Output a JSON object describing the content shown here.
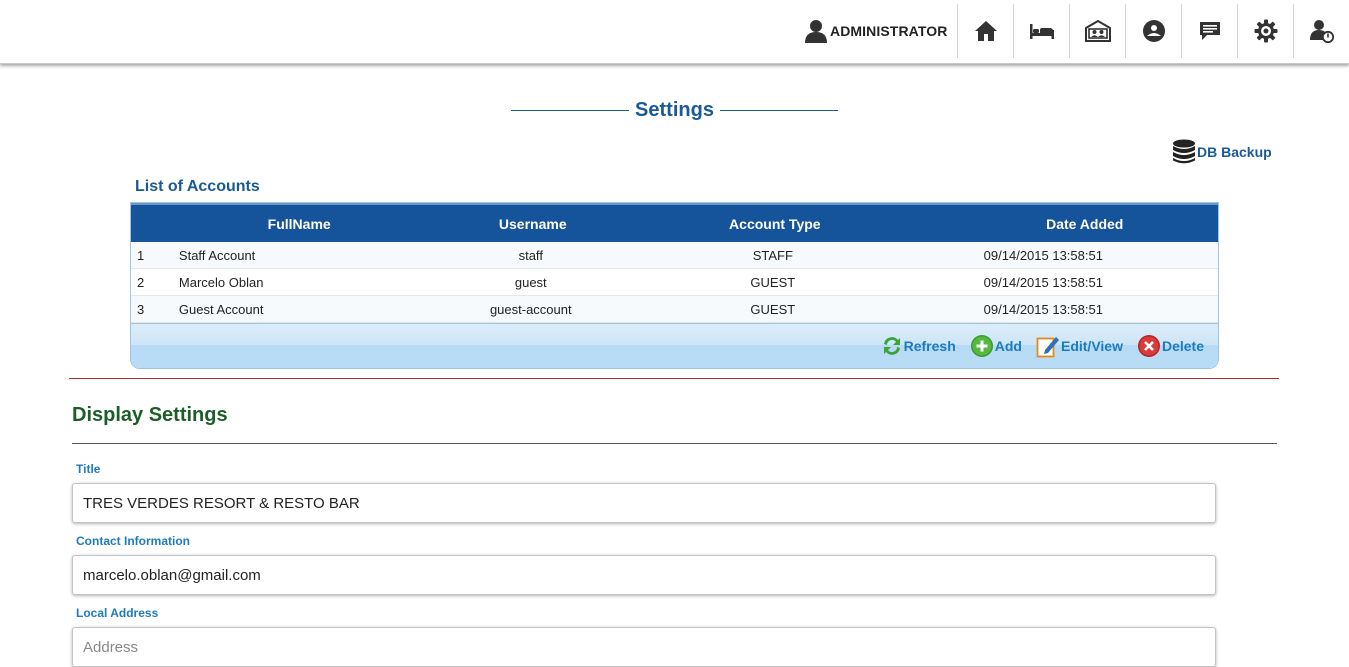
{
  "header": {
    "user_label": "ADMINISTRATOR",
    "nav": [
      {
        "name": "home-icon"
      },
      {
        "name": "bed-icon"
      },
      {
        "name": "guest-card-icon"
      },
      {
        "name": "restaurant-icon"
      },
      {
        "name": "message-icon"
      },
      {
        "name": "gear-icon"
      },
      {
        "name": "user-logout-icon"
      }
    ]
  },
  "page": {
    "title": "Settings",
    "db_backup_label": "DB Backup"
  },
  "accounts": {
    "title": "List of Accounts",
    "columns": [
      "FullName",
      "Username",
      "Account Type",
      "Date Added"
    ],
    "rows": [
      {
        "num": "1",
        "fullname": "Staff Account",
        "username": "staff",
        "type": "STAFF",
        "date": "09/14/2015 13:58:51"
      },
      {
        "num": "2",
        "fullname": "Marcelo Oblan",
        "username": "guest",
        "type": "GUEST",
        "date": "09/14/2015 13:58:51"
      },
      {
        "num": "3",
        "fullname": "Guest Account",
        "username": "guest-account",
        "type": "GUEST",
        "date": "09/14/2015 13:58:51"
      }
    ],
    "tools": {
      "refresh": "Refresh",
      "add": "Add",
      "edit": "Edit/View",
      "delete": "Delete"
    }
  },
  "display_settings": {
    "title": "Display Settings",
    "title_label": "Title",
    "title_value": "TRES VERDES RESORT & RESTO BAR",
    "contact_label": "Contact Information",
    "contact_value": "marcelo.oblan@gmail.com",
    "address_label": "Local Address",
    "address_value": "",
    "address_placeholder": "Address"
  },
  "colors": {
    "primary_blue": "#15539a",
    "link_blue": "#1e7bbd",
    "section_green": "#1c5e28",
    "separator_red": "#c0282d"
  }
}
